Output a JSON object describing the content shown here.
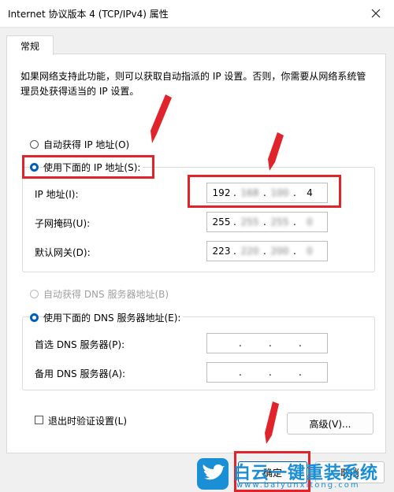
{
  "window": {
    "title": "Internet 协议版本 4 (TCP/IPv4) 属性"
  },
  "tab": {
    "label": "常规"
  },
  "intro_text": "如果网络支持此功能，则可以获取自动指派的 IP 设置。否则，你需要从网络系统管理员处获得适当的 IP 设置。",
  "ip": {
    "auto_label": "自动获得 IP 地址(O)",
    "manual_label": "使用下面的 IP 地址(S):",
    "fields": {
      "address_label": "IP 地址(I):",
      "address_values": [
        "192",
        "168",
        "100",
        "4"
      ],
      "subnet_label": "子网掩码(U):",
      "subnet_values": [
        "255",
        "255",
        "255",
        "0"
      ],
      "gateway_label": "默认网关(D):",
      "gateway_values": [
        "223",
        "220",
        "200",
        "0"
      ]
    }
  },
  "dns": {
    "auto_label": "自动获得 DNS 服务器地址(B)",
    "manual_label": "使用下面的 DNS 服务器地址(E):",
    "preferred_label": "首选 DNS 服务器(P):",
    "alternate_label": "备用 DNS 服务器(A):"
  },
  "validate_label": "退出时验证设置(L)",
  "buttons": {
    "advanced": "高级(V)...",
    "ok": "确定",
    "cancel": "取消"
  },
  "watermark": {
    "brand": "白云一键重装系统",
    "url": "www.baiyunxitong.com"
  },
  "colors": {
    "accent": "#005fb8",
    "highlight": "#e0242b",
    "brand_blue": "#1b8fd6"
  }
}
